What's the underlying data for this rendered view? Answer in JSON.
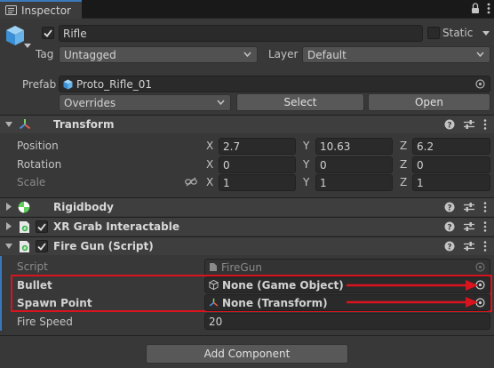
{
  "window": {
    "tab_title": "Inspector",
    "lock_icon": "lock-icon",
    "menu_icon": "kebab-menu-icon"
  },
  "gameobject": {
    "active_checked": true,
    "name": "Rifle",
    "static_label": "Static",
    "static_checked": false,
    "tag_label": "Tag",
    "tag_value": "Untagged",
    "layer_label": "Layer",
    "layer_value": "Default"
  },
  "prefab": {
    "label": "Prefab",
    "asset_name": "Proto_Rifle_01",
    "overrides_label": "Overrides",
    "select_label": "Select",
    "open_label": "Open"
  },
  "transform": {
    "title": "Transform",
    "rows": [
      {
        "label": "Position",
        "x": "2.7",
        "y": "10.63",
        "z": "6.2",
        "bold": true
      },
      {
        "label": "Rotation",
        "x": "0",
        "y": "0",
        "z": "0",
        "bold": true
      },
      {
        "label": "Scale",
        "x": "1",
        "y": "1",
        "z": "1",
        "bold": false
      }
    ],
    "axis_x": "X",
    "axis_y": "Y",
    "axis_z": "Z"
  },
  "components": {
    "rigidbody": "Rigidbody",
    "xr_grab": "XR Grab Interactable",
    "fire_gun": "Fire Gun (Script)"
  },
  "fire_gun": {
    "script_label": "Script",
    "script_value": "FireGun",
    "bullet_label": "Bullet",
    "bullet_value": "None (Game Object)",
    "spawn_label": "Spawn Point",
    "spawn_value": "None (Transform)",
    "speed_label": "Fire Speed",
    "speed_value": "20"
  },
  "footer": {
    "add_component_label": "Add Component"
  },
  "colors": {
    "accent_blue": "#3a79bb",
    "annotation_red": "#d9141e",
    "background": "#383838"
  }
}
